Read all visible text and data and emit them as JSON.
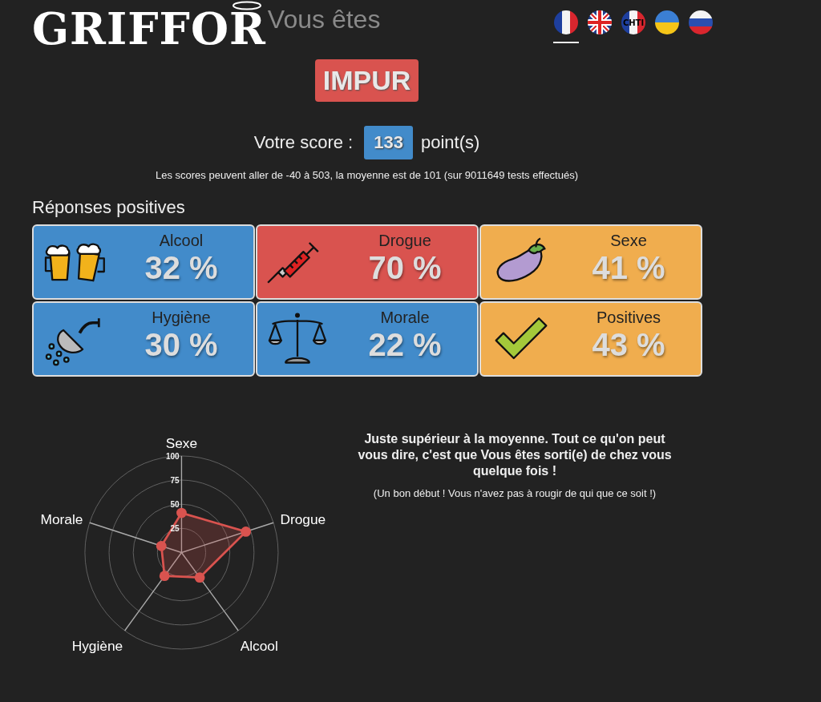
{
  "header": {
    "logo": "GRIFFOR",
    "tagline": "Vous êtes",
    "languages": [
      {
        "kind": "fr",
        "selected": true
      },
      {
        "kind": "gb",
        "selected": false
      },
      {
        "kind": "chti",
        "label": "CHTI",
        "selected": false
      },
      {
        "kind": "ua",
        "selected": false
      },
      {
        "kind": "ru",
        "selected": false
      }
    ]
  },
  "verdict": "IMPUR",
  "score": {
    "label": "Votre score :",
    "value": "133",
    "unit": "point(s)"
  },
  "score_note": "Les scores peuvent aller de -40 à 503, la moyenne est de 101 (sur 9011649 tests effectués)",
  "section_title": "Réponses positives",
  "categories": [
    {
      "kind": "beer",
      "name": "Alcool",
      "value": "32 %",
      "color": "#428bca"
    },
    {
      "kind": "syringe",
      "name": "Drogue",
      "value": "70 %",
      "color": "#d9534f"
    },
    {
      "kind": "eggplant",
      "name": "Sexe",
      "value": "41 %",
      "color": "#f0ad4e"
    },
    {
      "kind": "shower",
      "name": "Hygiène",
      "value": "30 %",
      "color": "#428bca"
    },
    {
      "kind": "scales",
      "name": "Morale",
      "value": "22 %",
      "color": "#428bca"
    },
    {
      "kind": "check",
      "name": "Positives",
      "value": "43 %",
      "color": "#f0ad4e"
    }
  ],
  "chart_data": {
    "type": "radar",
    "categories": [
      "Sexe",
      "Drogue",
      "Alcool",
      "Hygiène",
      "Morale"
    ],
    "ylim": [
      0,
      100
    ],
    "yticks": [
      25,
      50,
      75,
      100
    ],
    "series": [
      {
        "color": "#d9534f",
        "values": [
          41,
          70,
          32,
          30,
          22
        ]
      }
    ]
  },
  "comment": {
    "headline": "Juste supérieur à la moyenne. Tout ce qu'on peut vous dire, c'est que Vous êtes sorti(e) de chez vous quelque fois !",
    "subtext": "(Un bon début ! Vous n'avez pas à rougir de qui que ce soit !)"
  }
}
